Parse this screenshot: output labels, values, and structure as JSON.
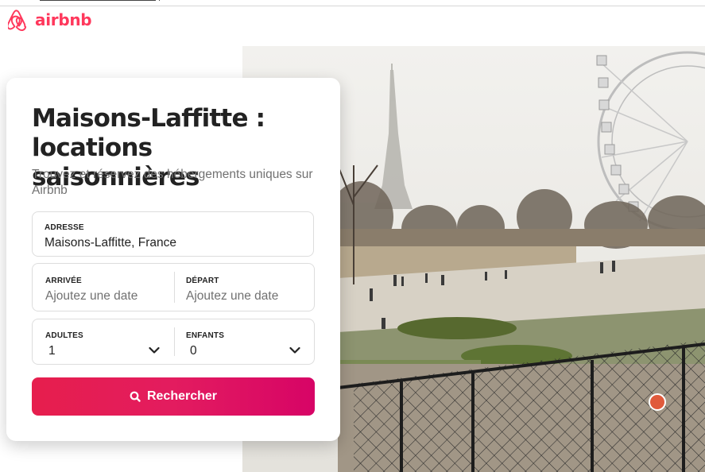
{
  "brand": {
    "logo_text": "airbnb",
    "color": "#ff385c",
    "icon": "airbnb-belo-icon"
  },
  "search_card": {
    "title_line1": "Maisons-Laffitte :",
    "title_line2": "locations saisonnières",
    "subtitle": "Trouvez et réservez des hébergements uniques sur Airbnb",
    "address": {
      "label": "ADRESSE",
      "value": "Maisons-Laffitte, France"
    },
    "arrival": {
      "label": "ARRIVÉE",
      "placeholder": "Ajoutez une date"
    },
    "departure": {
      "label": "DÉPART",
      "placeholder": "Ajoutez une date"
    },
    "adults": {
      "label": "ADULTES",
      "value": "1",
      "icon": "chevron-down-icon"
    },
    "children": {
      "label": "ENFANTS",
      "value": "0",
      "icon": "chevron-down-icon"
    },
    "search_button": {
      "label": "Rechercher",
      "icon": "search-icon",
      "gradient": [
        "#e61e4d",
        "#e31c5f",
        "#d70466"
      ]
    }
  },
  "hero": {
    "description_icon": "hero-photo"
  }
}
